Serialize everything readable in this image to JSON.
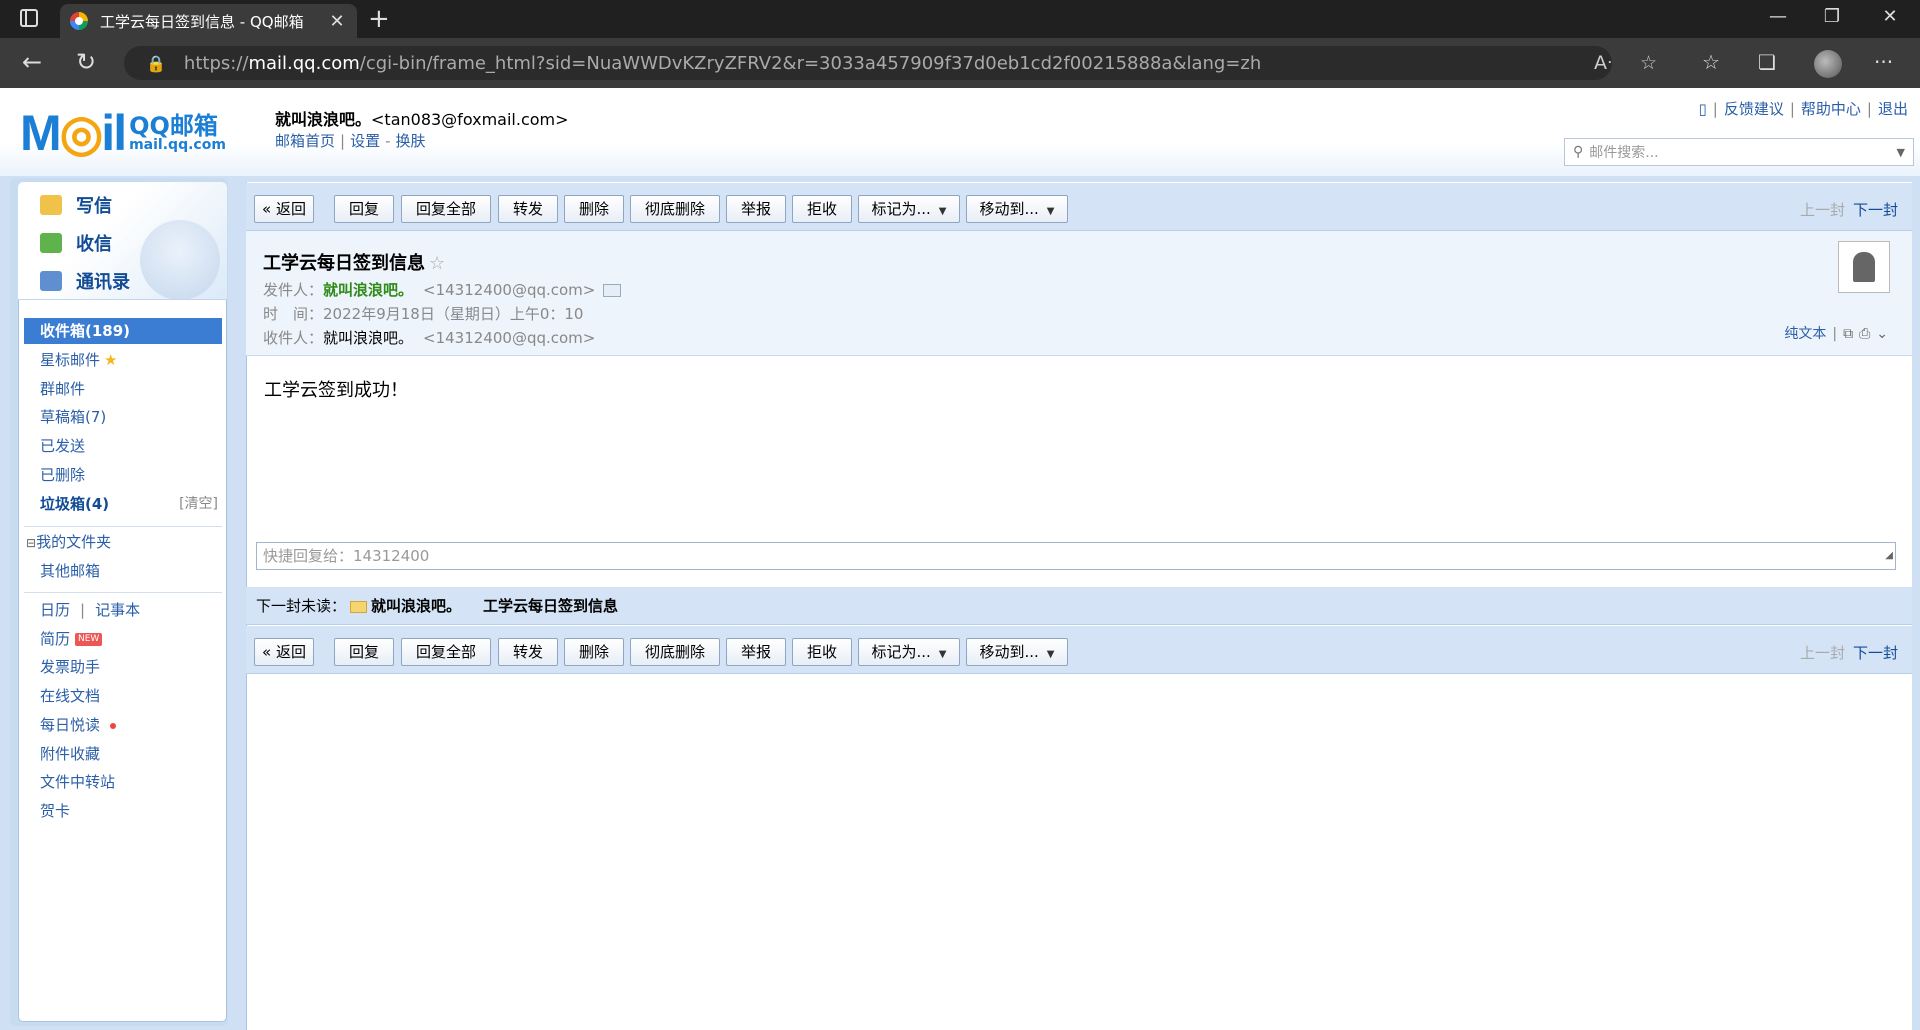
{
  "browser": {
    "tab_title": "工学云每日签到信息 - QQ邮箱",
    "url_prefix": "https://",
    "url_host": "mail.qq.com",
    "url_rest": "/cgi-bin/frame_html?sid=NuaWWDvKZryZFRV2&r=3033a457909f37d0eb1cd2f00215888a&lang=zh"
  },
  "header": {
    "logo_main": "QQ邮箱",
    "logo_sub": "mail.qq.com",
    "user_name": "就叫浪浪吧。",
    "user_email": "<tan083@foxmail.com>",
    "links": [
      "邮箱首页",
      "设置",
      "换肤"
    ],
    "top_links": [
      "反馈建议",
      "帮助中心",
      "退出"
    ],
    "search_placeholder": "邮件搜索..."
  },
  "sidebar": {
    "quick": [
      "写信",
      "收信",
      "通讯录"
    ],
    "folders": {
      "inbox": "收件箱(189)",
      "starred": "星标邮件",
      "group": "群邮件",
      "drafts": "草稿箱(7)",
      "sent": "已发送",
      "deleted": "已删除",
      "spam": "垃圾箱(4)",
      "spam_clear": "[清空]"
    },
    "my_folders": "我的文件夹",
    "other_mail": "其他邮箱",
    "calendar": "日历",
    "notebook": "记事本",
    "resume": "简历",
    "resume_badge": "NEW",
    "invoice": "发票助手",
    "docs": "在线文档",
    "daily": "每日悦读",
    "attachments": "附件收藏",
    "transfer": "文件中转站",
    "cards": "贺卡"
  },
  "toolbar": {
    "back": "« 返回",
    "reply": "回复",
    "reply_all": "回复全部",
    "forward": "转发",
    "delete": "删除",
    "delete_perm": "彻底删除",
    "report": "举报",
    "reject": "拒收",
    "mark_as": "标记为...",
    "move_to": "移动到...",
    "prev": "上一封",
    "next": "下一封"
  },
  "email": {
    "subject": "工学云每日签到信息",
    "from_label": "发件人：",
    "from_name": "就叫浪浪吧。",
    "from_email": "<14312400@qq.com>",
    "time_label": "时　间：",
    "time_value": "2022年9月18日（星期日）上午0：10",
    "to_label": "收件人：",
    "to_name": "就叫浪浪吧。",
    "to_email": "<14312400@qq.com>",
    "plain_text": "纯文本",
    "body": "工学云签到成功！"
  },
  "quick_reply": {
    "placeholder": "快捷回复给：14312400"
  },
  "next_unread": {
    "label": "下一封未读：",
    "sender": "就叫浪浪吧。",
    "subject": "工学云每日签到信息"
  }
}
